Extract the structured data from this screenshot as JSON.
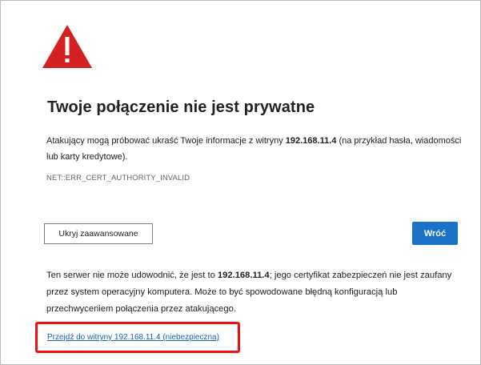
{
  "icons": {
    "warning": "warning-triangle-icon",
    "warning_color": "#d32020"
  },
  "page": {
    "title": "Twoje połączenie nie jest prywatne",
    "description_prefix": "Atakujący mogą próbować ukraść Twoje informacje z witryny ",
    "description_host": "192.168.11.4",
    "description_suffix": " (na przykład hasła, wiadomości lub karty kredytowe).",
    "error_code": "NET::ERR_CERT_AUTHORITY_INVALID"
  },
  "buttons": {
    "hide_advanced": "Ukryj zaawansowane",
    "back": "Wróć",
    "back_color": "#1a73c8"
  },
  "advanced": {
    "details_prefix": "Ten serwer nie może udowodnić, że jest to ",
    "details_host": "192.168.11.4",
    "details_suffix": "; jego certyfikat zabezpieczeń nie jest zaufany przez system operacyjny komputera. Może to być spowodowane błędną konfiguracją lub przechwyceniem połączenia przez atakującego.",
    "proceed_link": "Przejdź do witryny 192.168.11.4 (niebezpieczna)"
  },
  "highlight": {
    "color": "#ee1111"
  }
}
